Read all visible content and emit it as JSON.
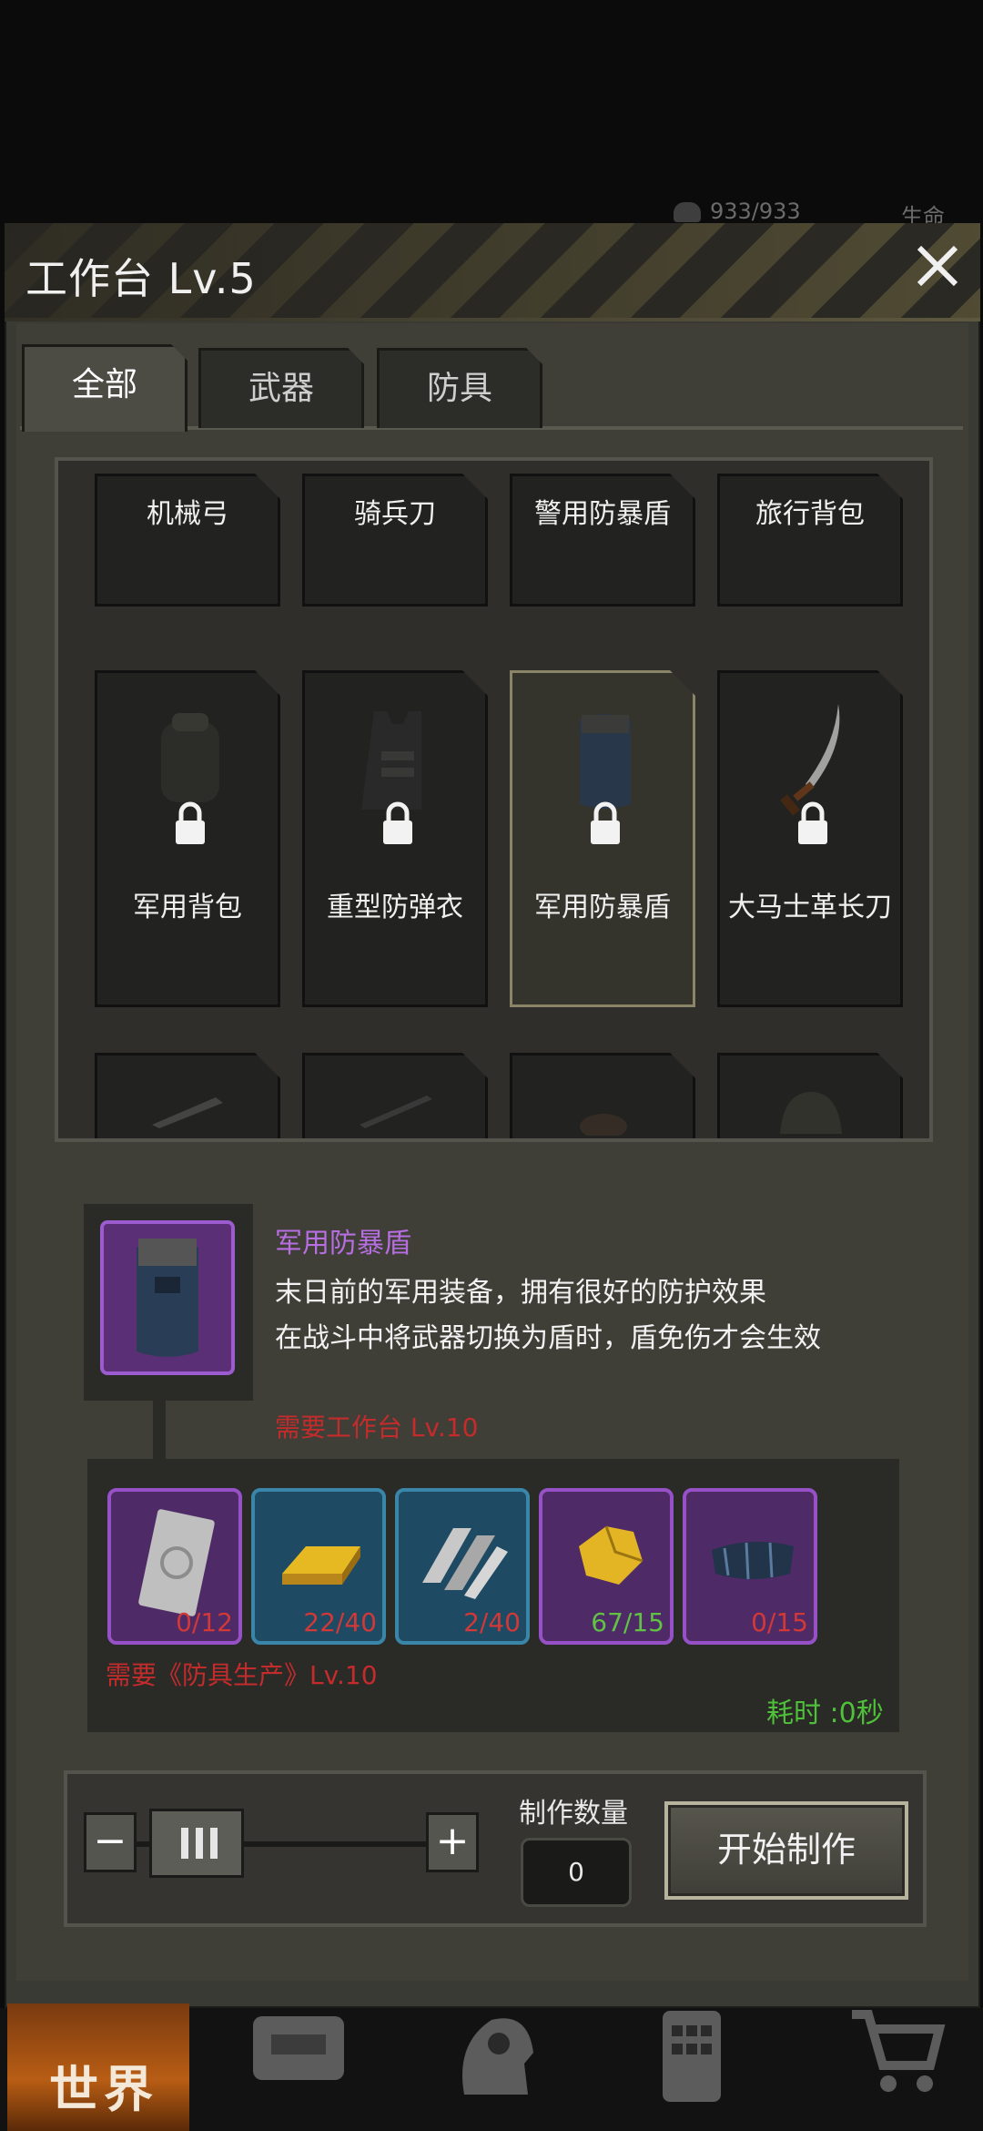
{
  "hud": {
    "hp": "933/933",
    "life_label": "生命"
  },
  "header": {
    "title": "工作台 Lv.5",
    "close_icon": "close-icon"
  },
  "tabs": [
    {
      "label": "全部",
      "active": true
    },
    {
      "label": "武器",
      "active": false
    },
    {
      "label": "防具",
      "active": false
    }
  ],
  "grid": {
    "row1": [
      "机械弓",
      "骑兵刀",
      "警用防暴盾",
      "旅行背包"
    ],
    "row2": [
      {
        "label": "军用背包",
        "locked": true,
        "icon": "backpack-icon"
      },
      {
        "label": "重型防弹衣",
        "locked": true,
        "icon": "vest-icon"
      },
      {
        "label": "军用防暴盾",
        "locked": true,
        "icon": "shield-icon",
        "selected": true
      },
      {
        "label": "大马士革长刀",
        "locked": true,
        "icon": "sword-icon"
      }
    ]
  },
  "detail": {
    "name": "军用防暴盾",
    "desc_line1": "末日前的军用装备，拥有很好的防护效果",
    "desc_line2": "在战斗中将武器切换为盾时，盾免伤才会生效",
    "requirement": "需要工作台 Lv.10"
  },
  "materials": [
    {
      "icon": "metal-plate-icon",
      "count": "0/12",
      "rarity": "purple",
      "enough": false
    },
    {
      "icon": "gold-bar-icon",
      "count": "22/40",
      "rarity": "blue",
      "enough": false
    },
    {
      "icon": "steel-plates-icon",
      "count": "2/40",
      "rarity": "blue",
      "enough": false
    },
    {
      "icon": "gold-ore-icon",
      "count": "67/15",
      "rarity": "purple",
      "enough": true
    },
    {
      "icon": "fabric-icon",
      "count": "0/15",
      "rarity": "purple",
      "enough": false
    }
  ],
  "skill_requirement": "需要《防具生产》Lv.10",
  "time": "耗时 :0秒",
  "controls": {
    "minus": "−",
    "plus": "+",
    "qty_label": "制作数量",
    "qty_value": "0",
    "start_label": "开始制作"
  },
  "nav": {
    "world_label": "世界"
  }
}
